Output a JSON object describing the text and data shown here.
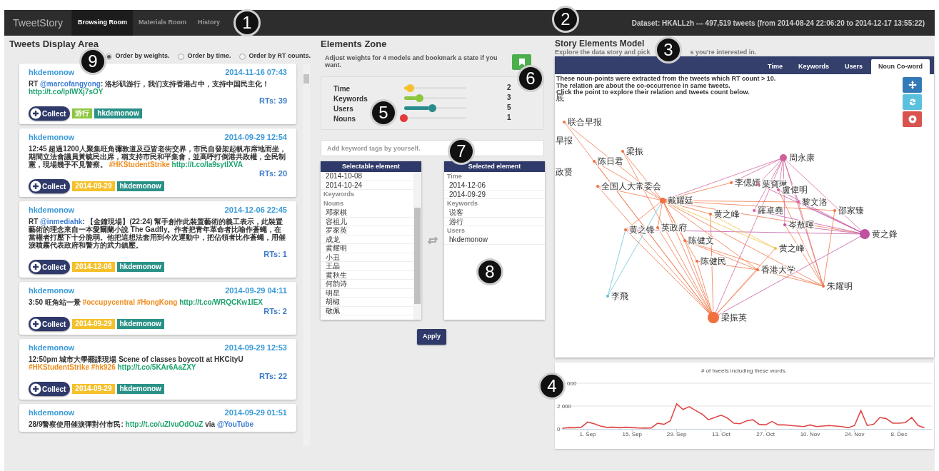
{
  "nav": {
    "brand": "TweetStory",
    "tabs": [
      {
        "label": "Browsing Room",
        "selected": true
      },
      {
        "label": "Materials Room",
        "selected": false
      },
      {
        "label": "History",
        "selected": false
      }
    ],
    "dataset": "Dataset: HKALLzh --- 497,519 tweets (from 2014-08-24 22:06:20 to 2014-12-17 13:55:22)"
  },
  "callouts": [
    "1",
    "2",
    "3",
    "4",
    "5",
    "6",
    "7",
    "8",
    "9"
  ],
  "tweets_area": {
    "title": "Tweets Display Area",
    "order_options": [
      {
        "label": "Order by weights.",
        "selected": true
      },
      {
        "label": "Order by time.",
        "selected": false
      },
      {
        "label": "Order by RT counts.",
        "selected": false
      }
    ],
    "tweets": [
      {
        "user": "hkdemonow",
        "time": "2014-11-16 07:43",
        "segments": [
          {
            "kind": "text",
            "text": "RT "
          },
          {
            "kind": "mention",
            "text": "@marcofangyong"
          },
          {
            "kind": "text",
            "text": ": 洛杉矶游行，我们支持香港占中，支持中国民主化！ "
          },
          {
            "kind": "link",
            "text": "http://t.co/lpIWXj7sOY"
          }
        ],
        "rts": "RTs: 39",
        "collect": "Collect",
        "tags": [
          {
            "text": "游行",
            "color": "#8cc63e"
          },
          {
            "text": "hkdemonow",
            "color": "#2a9187"
          }
        ]
      },
      {
        "user": "hkdemonow",
        "time": "2014-09-29 12:54",
        "segments": [
          {
            "kind": "text",
            "text": "12:45 超過1200人聚集旺角彌敦道及亞皆老街交界，市民自發架起帆布席地而坐，期間立法會議員黃毓民出席，稱支持市民和平集會，並高呼打倒港共政權，全民制憲，現場幾乎不見警察。 "
          },
          {
            "kind": "hashtag",
            "text": "#HKStudentStrike"
          },
          {
            "kind": "link",
            "text": "http://t.co/la9sytlXVA"
          }
        ],
        "rts": "RTs: 20",
        "collect": "Collect",
        "tags": [
          {
            "text": "2014-09-29",
            "color": "#f5c02a"
          },
          {
            "text": "hkdemonow",
            "color": "#2a9187"
          }
        ]
      },
      {
        "user": "hkdemonow",
        "time": "2014-12-06 22:45",
        "segments": [
          {
            "kind": "text",
            "text": "RT "
          },
          {
            "kind": "mention",
            "text": "@inmediahk"
          },
          {
            "kind": "text",
            "text": ": 【金鐘現場】(22:24) 幫手創作此裝置藝術的義工表示，此裝置藝術的理念來自一本愛爾蘭小說 The Gadfly。作者把青年革命者比喻作蒼蠅，在當權者打壓下十分脆弱。他把這想法套用到今次運動中，把佔領者比作蒼蠅，用催淚噴霧代表政府和警方的武力鎮壓。"
          }
        ],
        "rts": "RTs: 1",
        "collect": "Collect",
        "tags": [
          {
            "text": "2014-12-06",
            "color": "#f5c02a"
          },
          {
            "text": "hkdemonow",
            "color": "#2a9187"
          }
        ]
      },
      {
        "user": "hkdemonow",
        "time": "2014-09-29 04:11",
        "segments": [
          {
            "kind": "text",
            "text": "3:50 旺角站一景 "
          },
          {
            "kind": "hashtag",
            "text": "#occupycentral"
          },
          {
            "kind": "hashtag",
            "text": "#HongKong"
          },
          {
            "kind": "link",
            "text": "http://t.co/WRQCKw1lEX"
          }
        ],
        "rts": "RTs: 2",
        "collect": "Collect",
        "tags": [
          {
            "text": "2014-09-29",
            "color": "#f5c02a"
          },
          {
            "text": "hkdemonow",
            "color": "#2a9187"
          }
        ]
      },
      {
        "user": "hkdemonow",
        "time": "2014-09-29 12:53",
        "segments": [
          {
            "kind": "text",
            "text": "12:50pm 城市大學罷課現場 Scene of classes boycott at HKCityU "
          },
          {
            "kind": "hashtag",
            "text": "#HKStudentStrike"
          },
          {
            "kind": "hashtag",
            "text": "#hk926"
          },
          {
            "kind": "link",
            "text": "http://t.co/5KAr6AaZXY"
          }
        ],
        "rts": "RTs: 22",
        "collect": "Collect",
        "tags": [
          {
            "text": "2014-09-29",
            "color": "#f5c02a"
          },
          {
            "text": "hkdemonow",
            "color": "#2a9187"
          }
        ]
      },
      {
        "user": "hkdemonow",
        "time": "2014-09-29 01:51",
        "segments": [
          {
            "kind": "text",
            "text": "28/9警察使用催淚彈對付市民: "
          },
          {
            "kind": "link",
            "text": "http://t.co/uZlvuOdOuZ"
          },
          {
            "kind": "text",
            "text": " via "
          },
          {
            "kind": "mention",
            "text": "@YouTube"
          }
        ]
      }
    ]
  },
  "elements_zone": {
    "title": "Elements Zone",
    "description": "Adjust weights for 4 models and bookmark a state if you want.",
    "weights": [
      {
        "label": "Time",
        "level": 0.1,
        "value": "2",
        "color": "#f5c02a"
      },
      {
        "label": "Keywords",
        "level": 0.25,
        "value": "3",
        "color": "#8cc63e"
      },
      {
        "label": "Users",
        "level": 0.46,
        "value": "5",
        "color": "#2a8c8c"
      },
      {
        "label": "Nouns",
        "level": 0,
        "value": "1",
        "color": "#e23b3b"
      }
    ],
    "keyword_input": {
      "placeholder": "Add keyword tags by yourself."
    },
    "selectable": {
      "title": "Selectable element",
      "groups": [
        {
          "items": [
            "2014-10-08",
            "2014-10-24"
          ]
        },
        {
          "label": "Keywords"
        },
        {
          "label": "Nouns",
          "items": [
            "邓家棋",
            "容祖儿",
            "罗家英",
            "成龙",
            "黄耀明",
            "小丑",
            "王晶",
            "黄秋生",
            "何韵诗",
            "明星",
            "胡椒",
            "敬佩"
          ]
        }
      ]
    },
    "selected": {
      "title": "Selected element",
      "groups": [
        {
          "label": "Time",
          "items": [
            "2014-12-06",
            "2014-09-29"
          ]
        },
        {
          "label": "Keywords",
          "items": [
            "说客",
            "游行"
          ]
        },
        {
          "label": "Users",
          "items": [
            "hkdemonow"
          ]
        }
      ]
    },
    "apply": "Apply"
  },
  "story_model": {
    "title": "Story Elements Model",
    "subtitle_parts": [
      "Explore the data story and pick",
      "s you're interested in."
    ],
    "tabs": [
      {
        "label": "Time",
        "selected": false
      },
      {
        "label": "Keywords",
        "selected": false
      },
      {
        "label": "Users",
        "selected": false
      },
      {
        "label": "Noun Co-word",
        "selected": true
      }
    ],
    "notes": [
      "These noun-points were extracted from the tweets which RT count > 10.",
      "The relation are about the co-occurrence in same tweets.",
      "Click the point to explore their relation and tweets count below."
    ],
    "graph": {
      "nodes": [
        {
          "label": "底"
        },
        {
          "label": "联合早报",
          "color": "#f07040"
        },
        {
          "label": "早报"
        },
        {
          "label": "梁振",
          "color": "#f07040"
        },
        {
          "label": "陈日君",
          "color": "#f07040"
        },
        {
          "label": "政贤"
        },
        {
          "label": "全国人大常委会",
          "color": "#f07040"
        },
        {
          "label": "戴耀廷",
          "color": "#f07040"
        },
        {
          "label": "李偲嫣",
          "color": "#f07040"
        },
        {
          "label": "葉寶琳",
          "color": "#e0609a"
        },
        {
          "label": "盧偉明",
          "color": "#e0609a"
        },
        {
          "label": "周永康",
          "color": "#d0609a"
        },
        {
          "label": "黎文洛",
          "color": "#e0609a"
        },
        {
          "label": "邵家臻",
          "color": "#f07040"
        },
        {
          "label": "黄之峰",
          "color": "#f07040"
        },
        {
          "label": "羅卓堯",
          "color": "#e0609a"
        },
        {
          "label": "岑敖暉",
          "color": "#c050a0"
        },
        {
          "label": "黄之锋",
          "color": "#f07040"
        },
        {
          "label": "英政府",
          "color": "#f07040"
        },
        {
          "label": "陈健文",
          "color": "#f07040"
        },
        {
          "label": "黄之鋒",
          "color": "#c050a0"
        },
        {
          "label": "黄之峰",
          "color": "#f0c040"
        },
        {
          "label": "陈健民",
          "color": "#f07040"
        },
        {
          "label": "香港大学",
          "color": "#f07040"
        },
        {
          "label": "朱耀明",
          "color": "#f07040"
        },
        {
          "label": "李飛",
          "color": "#60c0d8"
        },
        {
          "label": "梁振英",
          "color": "#f07040"
        }
      ]
    },
    "chart_card": {
      "y_tick_fragment": "000",
      "chart_data": {
        "type": "line",
        "title": "# of tweets including these words.",
        "categories": [
          null,
          null,
          null,
          null,
          "1. Sep",
          null,
          null,
          null,
          null,
          null,
          null,
          "15. Sep",
          null,
          null,
          null,
          null,
          null,
          null,
          "29. Sep",
          null,
          null,
          null,
          null,
          null,
          null,
          "13. Oct",
          null,
          null,
          null,
          null,
          null,
          null,
          "27. Oct",
          null,
          null,
          null,
          null,
          null,
          null,
          "10. Nov",
          null,
          null,
          null,
          null,
          null,
          null,
          "24. Nov",
          null,
          null,
          null,
          null,
          null,
          null,
          "8. Dec",
          null,
          null,
          null,
          null
        ],
        "series": [
          {
            "color": "#e04848",
            "values": [
              50,
              120,
              100,
              150,
              600,
              450,
              250,
              130,
              150,
              100,
              150,
              120,
              80,
              70,
              80,
              500,
              400,
              700,
              2200,
              1700,
              1950,
              1600,
              1300,
              800,
              1000,
              1200,
              950,
              500,
              450,
              700,
              800,
              400,
              350,
              650,
              350,
              350,
              300,
              250,
              200,
              350,
              200,
              250,
              300,
              250,
              200,
              100,
              300,
              1600,
              300,
              400,
              1000,
              900,
              500,
              500,
              550,
              1000,
              300,
              100
            ]
          }
        ],
        "ylim": [
          0,
          4000
        ],
        "yticks": [
          {
            "value": 0,
            "label": "0"
          },
          {
            "value": 2000,
            "label": "2 000"
          }
        ]
      }
    }
  }
}
